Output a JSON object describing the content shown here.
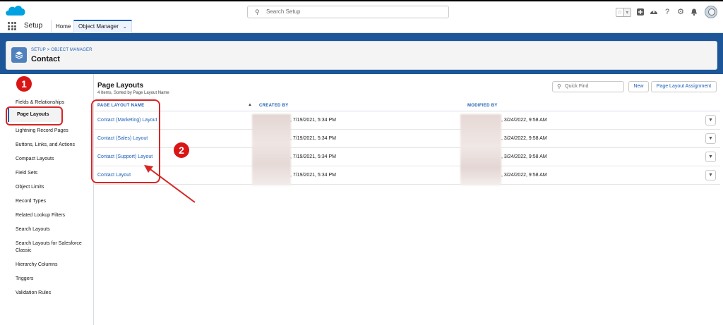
{
  "topbar": {
    "search_placeholder": "Search Setup",
    "icons": [
      "favorite-star-icon",
      "add-icon",
      "trailhead-icon",
      "help-icon",
      "gear-icon",
      "notification-bell-icon",
      "avatar"
    ]
  },
  "nav": {
    "app_name": "Setup",
    "tabs": [
      {
        "label": "Home"
      },
      {
        "label": "Object Manager"
      }
    ]
  },
  "header": {
    "breadcrumb": "SETUP > OBJECT MANAGER",
    "title": "Contact"
  },
  "sidebar": {
    "items": [
      {
        "label": "Fields & Relationships"
      },
      {
        "label": "Page Layouts",
        "active": true
      },
      {
        "label": "Lightning Record Pages"
      },
      {
        "label": "Buttons, Links, and Actions"
      },
      {
        "label": "Compact Layouts"
      },
      {
        "label": "Field Sets"
      },
      {
        "label": "Object Limits"
      },
      {
        "label": "Record Types"
      },
      {
        "label": "Related Lookup Filters"
      },
      {
        "label": "Search Layouts"
      },
      {
        "label": "Search Layouts for Salesforce Classic"
      },
      {
        "label": "Hierarchy Columns"
      },
      {
        "label": "Triggers"
      },
      {
        "label": "Validation Rules"
      }
    ]
  },
  "main": {
    "title": "Page Layouts",
    "subtitle": "4 Items, Sorted by Page Layout Name",
    "quick_find_placeholder": "Quick Find",
    "new_button": "New",
    "assignment_button": "Page Layout Assignment",
    "columns": [
      "PAGE LAYOUT NAME",
      "CREATED BY",
      "MODIFIED BY"
    ],
    "rows": [
      {
        "name": "Contact (Marketing) Layout",
        "created": ", 7/19/2021, 5:34 PM",
        "modified": ", 3/24/2022, 9:58 AM"
      },
      {
        "name": "Contact (Sales) Layout",
        "created": ", 7/19/2021, 5:34 PM",
        "modified": ", 3/24/2022, 9:58 AM"
      },
      {
        "name": "Contact (Support) Layout",
        "created": ", 7/19/2021, 5:34 PM",
        "modified": ", 3/24/2022, 9:58 AM"
      },
      {
        "name": "Contact Layout",
        "created": ", 7/19/2021, 5:34 PM",
        "modified": ", 3/24/2022, 9:58 AM"
      }
    ]
  },
  "annotations": {
    "badge_1": "1",
    "badge_2": "2",
    "color": "#d62626"
  },
  "colors": {
    "brand_blue": "#1c5699",
    "link_blue": "#1b5eb7",
    "salesforce_cloud": "#00a1e0"
  }
}
